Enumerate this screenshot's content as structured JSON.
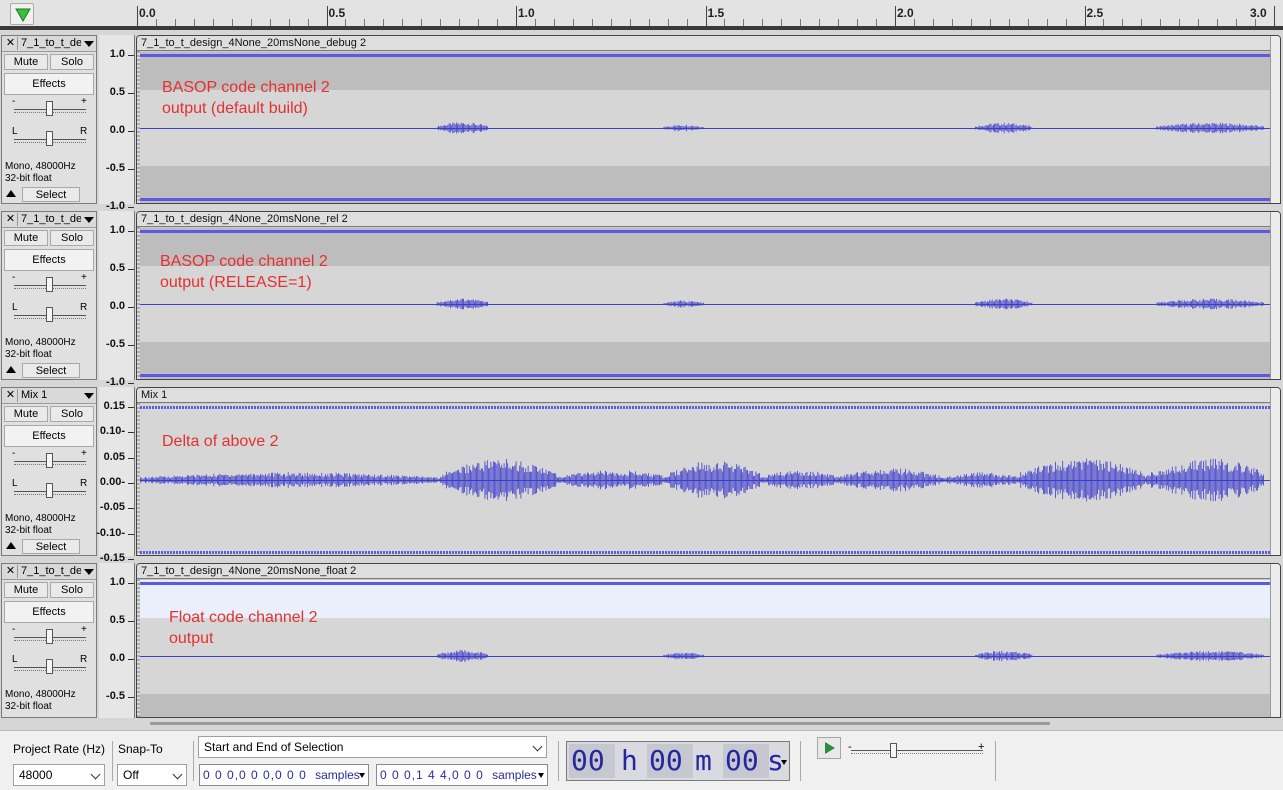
{
  "ruler": {
    "labels": [
      "0.0",
      "0.5",
      "1.0",
      "1.5",
      "2.0",
      "2.5",
      "3.0"
    ]
  },
  "common": {
    "mute": "Mute",
    "solo": "Solo",
    "effects": "Effects",
    "pan_left": "L",
    "pan_right": "R",
    "gain_minus": "-",
    "gain_plus": "+",
    "select": "Select",
    "format_rate": "Mono, 48000Hz",
    "format_depth": "32-bit float",
    "close": "✕"
  },
  "tracks": [
    {
      "name": "7_1_to_t_de",
      "clip_title": "7_1_to_t_design_4None_20msNone_debug 2",
      "annotation": "BASOP code channel 2\noutput (default build)",
      "scale": [
        "1.0",
        "0.5",
        "0.0",
        "-0.5",
        "-1.0"
      ]
    },
    {
      "name": "7_1_to_t_de",
      "clip_title": "7_1_to_t_design_4None_20msNone_rel 2",
      "annotation": "BASOP code channel 2\noutput (RELEASE=1)",
      "scale": [
        "1.0",
        "0.5",
        "0.0",
        "-0.5",
        "-1.0"
      ]
    },
    {
      "name": "Mix 1",
      "clip_title": "Mix 1",
      "annotation": "Delta of above 2",
      "scale": [
        "0.15",
        "0.10-",
        "0.05",
        "0.00-",
        "-0.05",
        "-0.10-",
        "-0.15"
      ]
    },
    {
      "name": "7_1_to_t_de",
      "clip_title": "7_1_to_t_design_4None_20msNone_float 2",
      "annotation": "Float code channel 2\noutput",
      "scale": [
        "1.0",
        "0.5",
        "0.0",
        "-0.5"
      ]
    }
  ],
  "toolbar": {
    "project_rate_label": "Project Rate (Hz)",
    "project_rate_value": "48000",
    "snap_to_label": "Snap-To",
    "snap_to_value": "Off",
    "selection_mode": "Start and End of Selection",
    "sel_start": "0 0 0,0 0 0,0 0 0",
    "sel_end": "0 0 0,1 4 4,0 0 0",
    "samples_unit": "samples",
    "time_h": "00",
    "time_h_unit": "h",
    "time_m": "00",
    "time_m_unit": "m",
    "time_s": "00",
    "time_s_unit": "s",
    "speed_minus": "-",
    "speed_plus": "+"
  },
  "colors": {
    "waveform": "#3d3dcc",
    "annotation": "#e53030",
    "play_green": "#2c8c3c"
  }
}
